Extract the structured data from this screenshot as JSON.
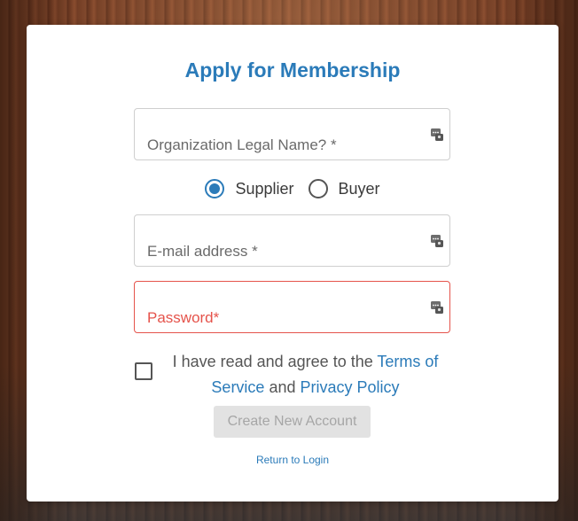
{
  "form": {
    "title": "Apply for Membership",
    "org_name": {
      "placeholder": "Organization Legal Name? *",
      "value": ""
    },
    "role": {
      "options": [
        {
          "label": "Supplier",
          "selected": true
        },
        {
          "label": "Buyer",
          "selected": false
        }
      ]
    },
    "email": {
      "placeholder": "E-mail address *",
      "value": ""
    },
    "password": {
      "placeholder": "Password*",
      "value": "",
      "state": "error"
    },
    "agreement": {
      "checked": false,
      "prefix": "I have read and agree to the",
      "terms_link": "Terms of Service",
      "conjunction": "and",
      "privacy_link": "Privacy Policy"
    },
    "submit_label": "Create New Account",
    "submit_disabled": true,
    "login_link": "Return to Login"
  },
  "colors": {
    "accent": "#2b7bb9",
    "error": "#e5534b",
    "disabled_button": "#e2e2e2"
  },
  "icons": {
    "field_autofill": "password-manager-icon"
  }
}
